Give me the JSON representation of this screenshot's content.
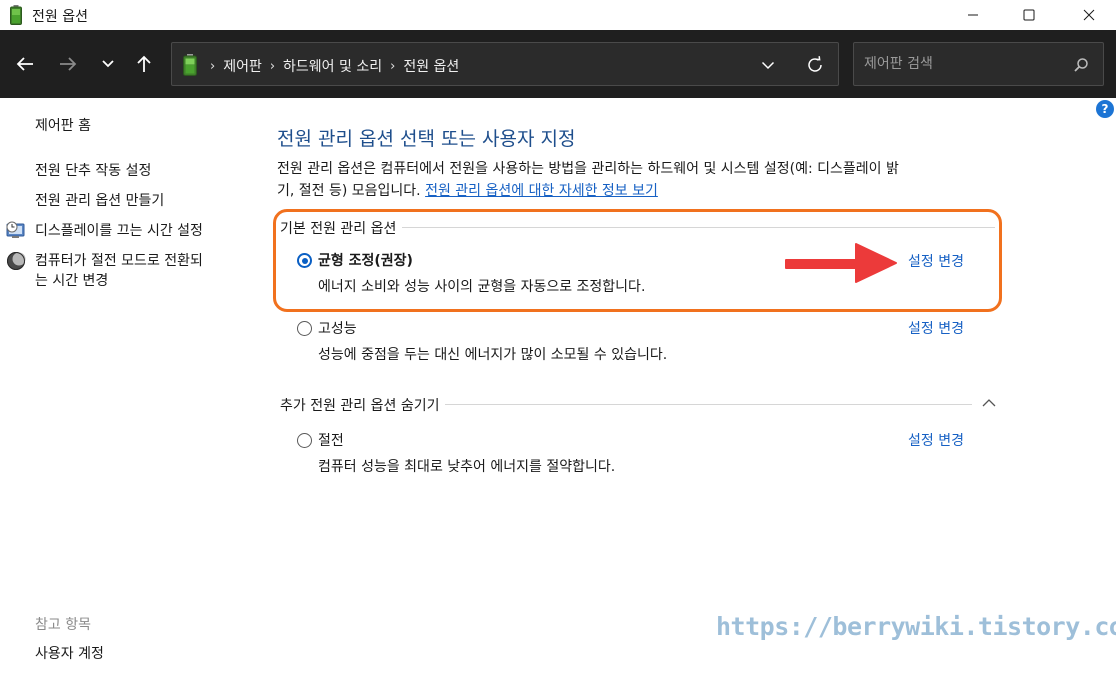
{
  "window": {
    "title": "전원 옵션",
    "controls": [
      "minimize-icon",
      "maximize-icon",
      "close-icon"
    ]
  },
  "address": {
    "breadcrumbs": [
      "제어판",
      "하드웨어 및 소리",
      "전원 옵션"
    ],
    "search_placeholder": "제어판 검색"
  },
  "sidebar": {
    "items": [
      {
        "label": "제어판 홈"
      },
      {
        "label": "전원 단추 작동 설정"
      },
      {
        "label": "전원 관리 옵션 만들기"
      },
      {
        "label": "디스플레이를 끄는 시간 설정",
        "icon": "display-clock-icon"
      },
      {
        "label_line1": "컴퓨터가 절전 모드로 전환되",
        "label_line2": "는 시간 변경",
        "icon": "moon-sleep-icon"
      }
    ],
    "see_also_heading": "참고 항목",
    "see_also_items": [
      {
        "label": "사용자 계정"
      }
    ]
  },
  "main": {
    "title": "전원 관리 옵션 선택 또는 사용자 지정",
    "description_line1": "전원 관리 옵션은 컴퓨터에서 전원을 사용하는 방법을 관리하는 하드웨어 및 시스템 설정(예: 디스플레이 밝",
    "description_line2": "기, 절전 등) 모음입니다.",
    "description_link": "전원 관리 옵션에 대한 자세한 정보 보기",
    "preferred_group_label": "기본 전원 관리 옵션",
    "hidden_group_label": "추가 전원 관리 옵션 숨기기",
    "plans": [
      {
        "name": "균형 조정(권장)",
        "desc": "에너지 소비와 성능 사이의 균형을 자동으로 조정합니다.",
        "link": "설정 변경",
        "selected": true
      },
      {
        "name": "고성능",
        "desc": "성능에 중점을 두는 대신 에너지가 많이 소모될 수 있습니다.",
        "link": "설정 변경",
        "selected": false
      },
      {
        "name": "절전",
        "desc": "컴퓨터 성능을 최대로 낮추어 에너지를 절약합니다.",
        "link": "설정 변경",
        "selected": false
      }
    ]
  },
  "watermark": "https://berrywiki.tistory.com",
  "colors": {
    "title_blue": "#1e4e8c",
    "link_blue": "#1761c4",
    "highlight_orange": "#f1711e",
    "arrow_red": "#ec3a3a",
    "navbar_bg": "#1f1f1f"
  }
}
